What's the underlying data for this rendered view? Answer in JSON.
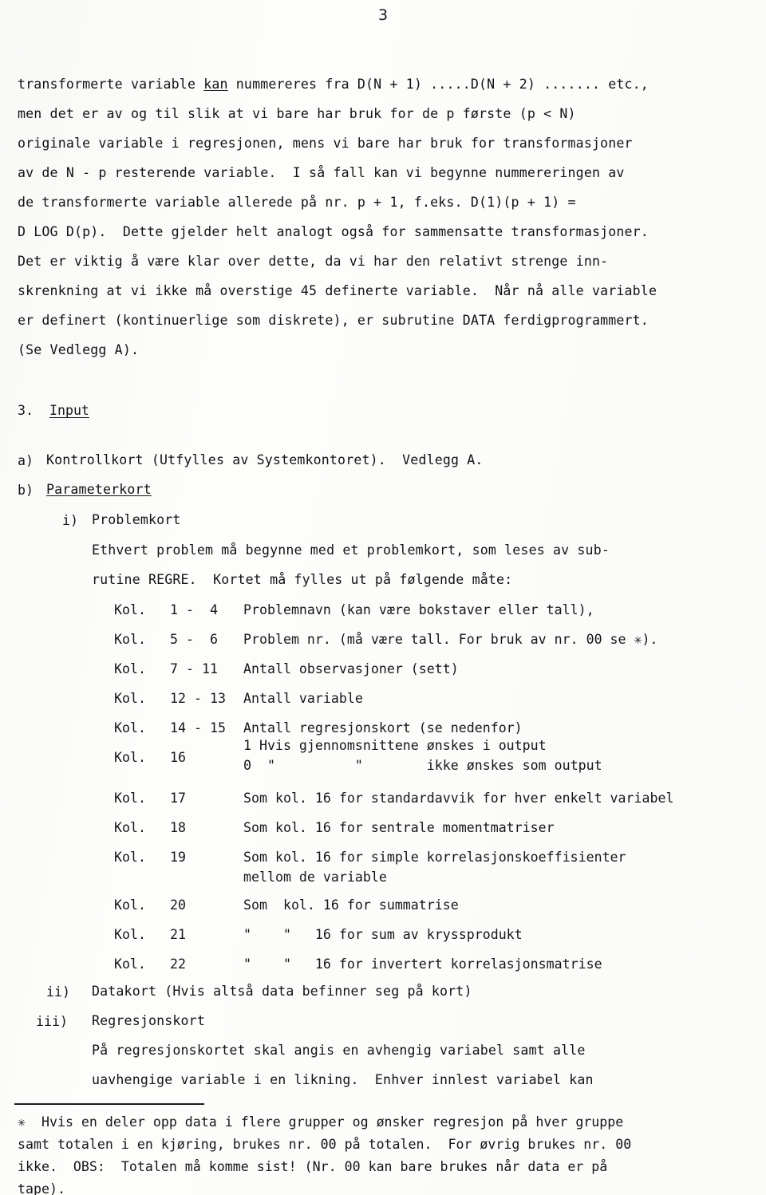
{
  "page": {
    "number": "3",
    "language": "Norwegian",
    "document_type": "typewritten technical manual page"
  },
  "body_paragraph": {
    "lines": [
      {
        "pre": "transformerte variable ",
        "underlined": "kan",
        "post": " nummereres fra D(N + 1) .....D(N + 2) ....... etc.,"
      },
      {
        "pre": "men det er av og til slik at vi bare har bruk for de p første (p < N)",
        "underlined": "",
        "post": ""
      },
      {
        "pre": "originale variable i regresjonen, mens vi bare har bruk for transformasjoner",
        "underlined": "",
        "post": ""
      },
      {
        "pre": "av de N - p resterende variable.  I så fall kan vi begynne nummereringen av",
        "underlined": "",
        "post": ""
      },
      {
        "pre": "de transformerte variable allerede på nr. p + 1, f.eks. D(1)(p + 1) =",
        "underlined": "",
        "post": ""
      },
      {
        "pre": "D LOG D(p).  Dette gjelder helt analogt også for sammensatte transformasjoner.",
        "underlined": "",
        "post": ""
      },
      {
        "pre": "Det er viktig å være klar over dette, da vi har den relativt strenge inn-",
        "underlined": "",
        "post": ""
      },
      {
        "pre": "skrenkning at vi ikke må overstige 45 definerte variable.  Når nå alle variable",
        "underlined": "",
        "post": ""
      },
      {
        "pre": "er definert (kontinuerlige som diskrete), er subrutine DATA ferdigprogrammert.",
        "underlined": "",
        "post": ""
      },
      {
        "pre": "(Se Vedlegg A).",
        "underlined": "",
        "post": ""
      }
    ]
  },
  "section": {
    "number": "3.",
    "title": "Input"
  },
  "items": {
    "a": {
      "marker": "a)",
      "text": "Kontrollkort (Utfylles av Systemkontoret).  Vedlegg A."
    },
    "b": {
      "marker": "b)",
      "title": "Parameterkort"
    },
    "i": {
      "marker": "i)",
      "title": "Problemkort",
      "intro_lines": [
        "Ethvert problem må begynne med et problemkort, som leses av sub-",
        "rutine REGRE.  Kortet må fylles ut på følgende måte:"
      ]
    },
    "ii": {
      "marker": "ii)",
      "text": "Datakort (Hvis altså data befinner seg på kort)"
    },
    "iii": {
      "marker": "iii)",
      "title": "Regresjonskort",
      "body_lines": [
        "På regresjonskortet skal angis en avhengig variabel samt alle",
        "uavhengige variable i en likning.  Enhver innlest variabel kan"
      ]
    }
  },
  "kol_table": {
    "label": "Kol.",
    "rows": [
      {
        "label": "Kol.",
        "range": "1 -  4",
        "desc": "Problemnavn (kan være bokstaver eller tall),"
      },
      {
        "label": "Kol.",
        "range": "5 -  6",
        "desc": "Problem nr. (må være tall. For bruk av nr. 00 se ✳)."
      },
      {
        "label": "Kol.",
        "range": "7 - 11",
        "desc": "Antall observasjoner (sett)"
      },
      {
        "label": "Kol.",
        "range": "12 - 13",
        "desc": "Antall variable"
      },
      {
        "label": "Kol.",
        "range": "14 - 15",
        "desc": "Antall regresjonskort (se nedenfor)"
      },
      {
        "label": "Kol.",
        "range": "16",
        "desc": "1 Hvis gjennomsnittene ønskes i output",
        "desc2": "0  \"          \"        ikke ønskes som output"
      },
      {
        "label": "Kol.",
        "range": "17",
        "desc": "Som kol. 16 for standardavvik for hver enkelt variabel"
      },
      {
        "label": "Kol.",
        "range": "18",
        "desc": "Som kol. 16 for sentrale momentmatriser"
      },
      {
        "label": "Kol.",
        "range": "19",
        "desc": "Som kol. 16 for simple korrelasjonskoeffisienter",
        "desc2": "mellom de variable"
      },
      {
        "label": "Kol.",
        "range": "20",
        "desc": "Som  kol. 16 for summatrise"
      },
      {
        "label": "Kol.",
        "range": "21",
        "desc": "\"    \"   16 for sum av kryssprodukt"
      },
      {
        "label": "Kol.",
        "range": "22",
        "desc": "\"    \"   16 for invertert korrelasjonsmatrise"
      }
    ]
  },
  "footnote": {
    "marker": "✳",
    "lines": [
      "✳  Hvis en deler opp data i flere grupper og ønsker regresjon på hver gruppe",
      "samt totalen i en kjøring, brukes nr. 00 på totalen.  For øvrig brukes nr. 00",
      "ikke.  OBS:  Totalen må komme sist! (Nr. 00 kan bare brukes når data er på",
      "tape)."
    ]
  }
}
